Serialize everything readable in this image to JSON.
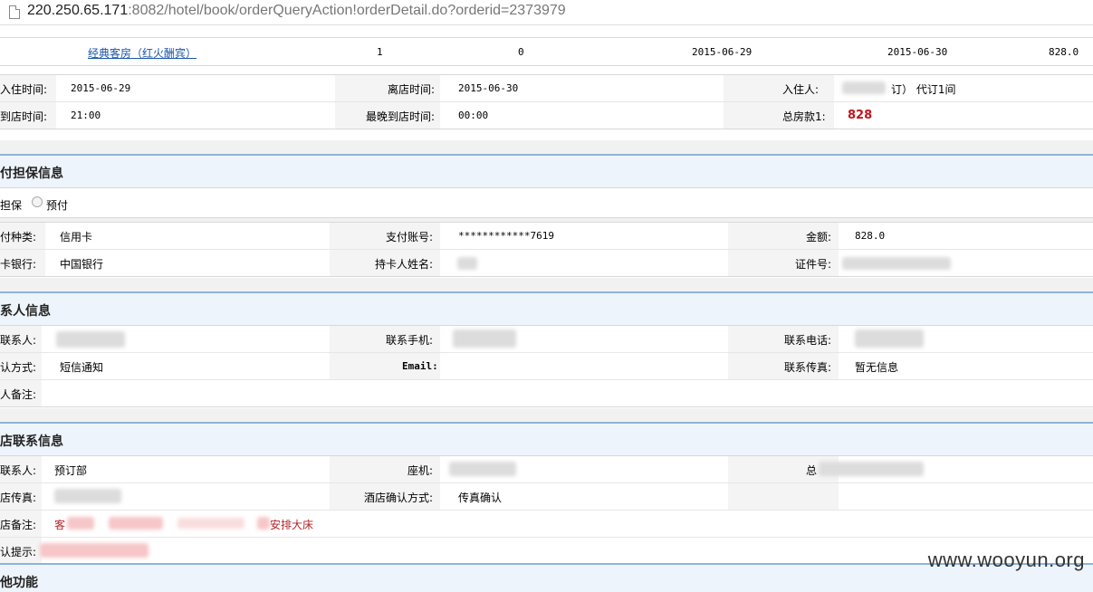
{
  "browser": {
    "url_host": "220.250.65.171",
    "url_rest": ":8082/hotel/book/orderQueryAction!orderDetail.do?orderid=2373979"
  },
  "room_row": {
    "room_type": "经典客房（红火酬宾）",
    "rooms": "1",
    "extra": "0",
    "checkin": "2015-06-29",
    "checkout": "2015-06-30",
    "price": "828.0"
  },
  "stay": {
    "checkin_label": "入住时间:",
    "checkin_value": "2015-06-29",
    "checkout_label": "离店时间:",
    "checkout_value": "2015-06-30",
    "guest_label": "入住人:",
    "guest_value": "订） 代订1间",
    "arrival_label": "到店时间:",
    "arrival_value": "21:00",
    "latest_label": "最晚到店时间:",
    "latest_value": "00:00",
    "total_label": "总房款1:",
    "total_value": "828"
  },
  "guarantee": {
    "title": "付担保信息",
    "opt_guarantee": "担保",
    "opt_prepay": "预付",
    "pay_type_label": "付种类:",
    "pay_type_value": "信用卡",
    "account_label": "支付账号:",
    "account_value": "************7619",
    "amount_label": "金额:",
    "amount_value": "828.0",
    "bank_label": "卡银行:",
    "bank_value": "中国银行",
    "holder_label": "持卡人姓名:",
    "id_label": "证件号:"
  },
  "contact": {
    "title": "系人信息",
    "person_label": "联系人:",
    "mobile_label": "联系手机:",
    "phone_label": "联系电话:",
    "confirm_label": "认方式:",
    "confirm_value": "短信通知",
    "email_label": "Email:",
    "fax_label": "联系传真:",
    "fax_value": "暂无信息",
    "note_label": "人备注:"
  },
  "hotel": {
    "title": "店联系信息",
    "person_label": "联系人:",
    "person_value": "预订部",
    "landline_label": "座机:",
    "total_label": "总",
    "fax_label": "店传真:",
    "confirm_label": "酒店确认方式:",
    "confirm_value": "传真确认",
    "note_label": "店备注:",
    "note_prefix": "客",
    "note_suffix": "安排大床",
    "tip_label": "认提示:"
  },
  "other": {
    "title": "他功能"
  },
  "watermark": "www.wooyun.org"
}
